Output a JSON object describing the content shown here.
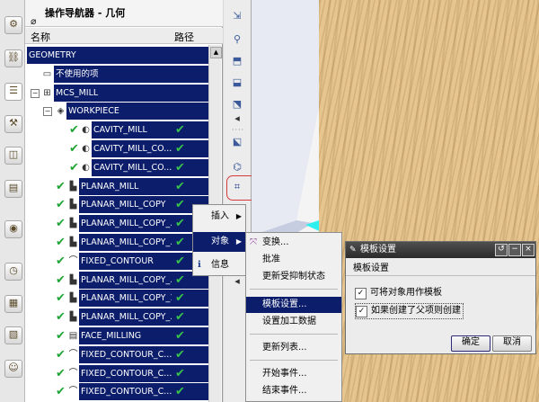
{
  "navigator": {
    "title": "操作导航器 - 几何",
    "col_name": "名称",
    "col_path": "路径",
    "rows": [
      {
        "name": "GEOMETRY",
        "check": false
      },
      {
        "name": "不使用的项",
        "check": false
      },
      {
        "name": "MCS_MILL",
        "check": false
      },
      {
        "name": "WORKPIECE",
        "check": false
      },
      {
        "name": "CAVITY_MILL",
        "check": true
      },
      {
        "name": "CAVITY_MILL_CO...",
        "check": true
      },
      {
        "name": "CAVITY_MILL_CO...",
        "check": true
      },
      {
        "name": "PLANAR_MILL",
        "check": true
      },
      {
        "name": "PLANAR_MILL_COPY",
        "check": true
      },
      {
        "name": "PLANAR_MILL_COPY_...",
        "check": true
      },
      {
        "name": "PLANAR_MILL_COPY_...",
        "check": true
      },
      {
        "name": "FIXED_CONTOUR",
        "check": true
      },
      {
        "name": "PLANAR_MILL_COPY_...",
        "check": true
      },
      {
        "name": "PLANAR_MILL_COPY_1",
        "check": true
      },
      {
        "name": "PLANAR_MILL_COPY_...",
        "check": true
      },
      {
        "name": "FACE_MILLING",
        "check": true
      },
      {
        "name": "FIXED_CONTOUR_C...",
        "check": true
      },
      {
        "name": "FIXED_CONTOUR_C...",
        "check": true
      },
      {
        "name": "FIXED_CONTOUR_C...",
        "check": true
      }
    ]
  },
  "context_menu": {
    "items": [
      "插入",
      "对象",
      "信息"
    ]
  },
  "submenu": {
    "items": [
      "变换...",
      "批准",
      "更新受抑制状态",
      "模板设置...",
      "设置加工数据",
      "更新列表...",
      "开始事件...",
      "结束事件..."
    ]
  },
  "dialog": {
    "title": "模板设置",
    "group": "模板设置",
    "option1": "可将对象用作模板",
    "option2": "如果创建了父项则创建",
    "ok": "确定",
    "cancel": "取消"
  },
  "colors": {
    "selection": "#0c1e6b",
    "path_check": "#38c14a",
    "wood": "#e6c58e",
    "cyan_surface": "#2ef0f0",
    "highlight_circle": "#d63a3a"
  }
}
